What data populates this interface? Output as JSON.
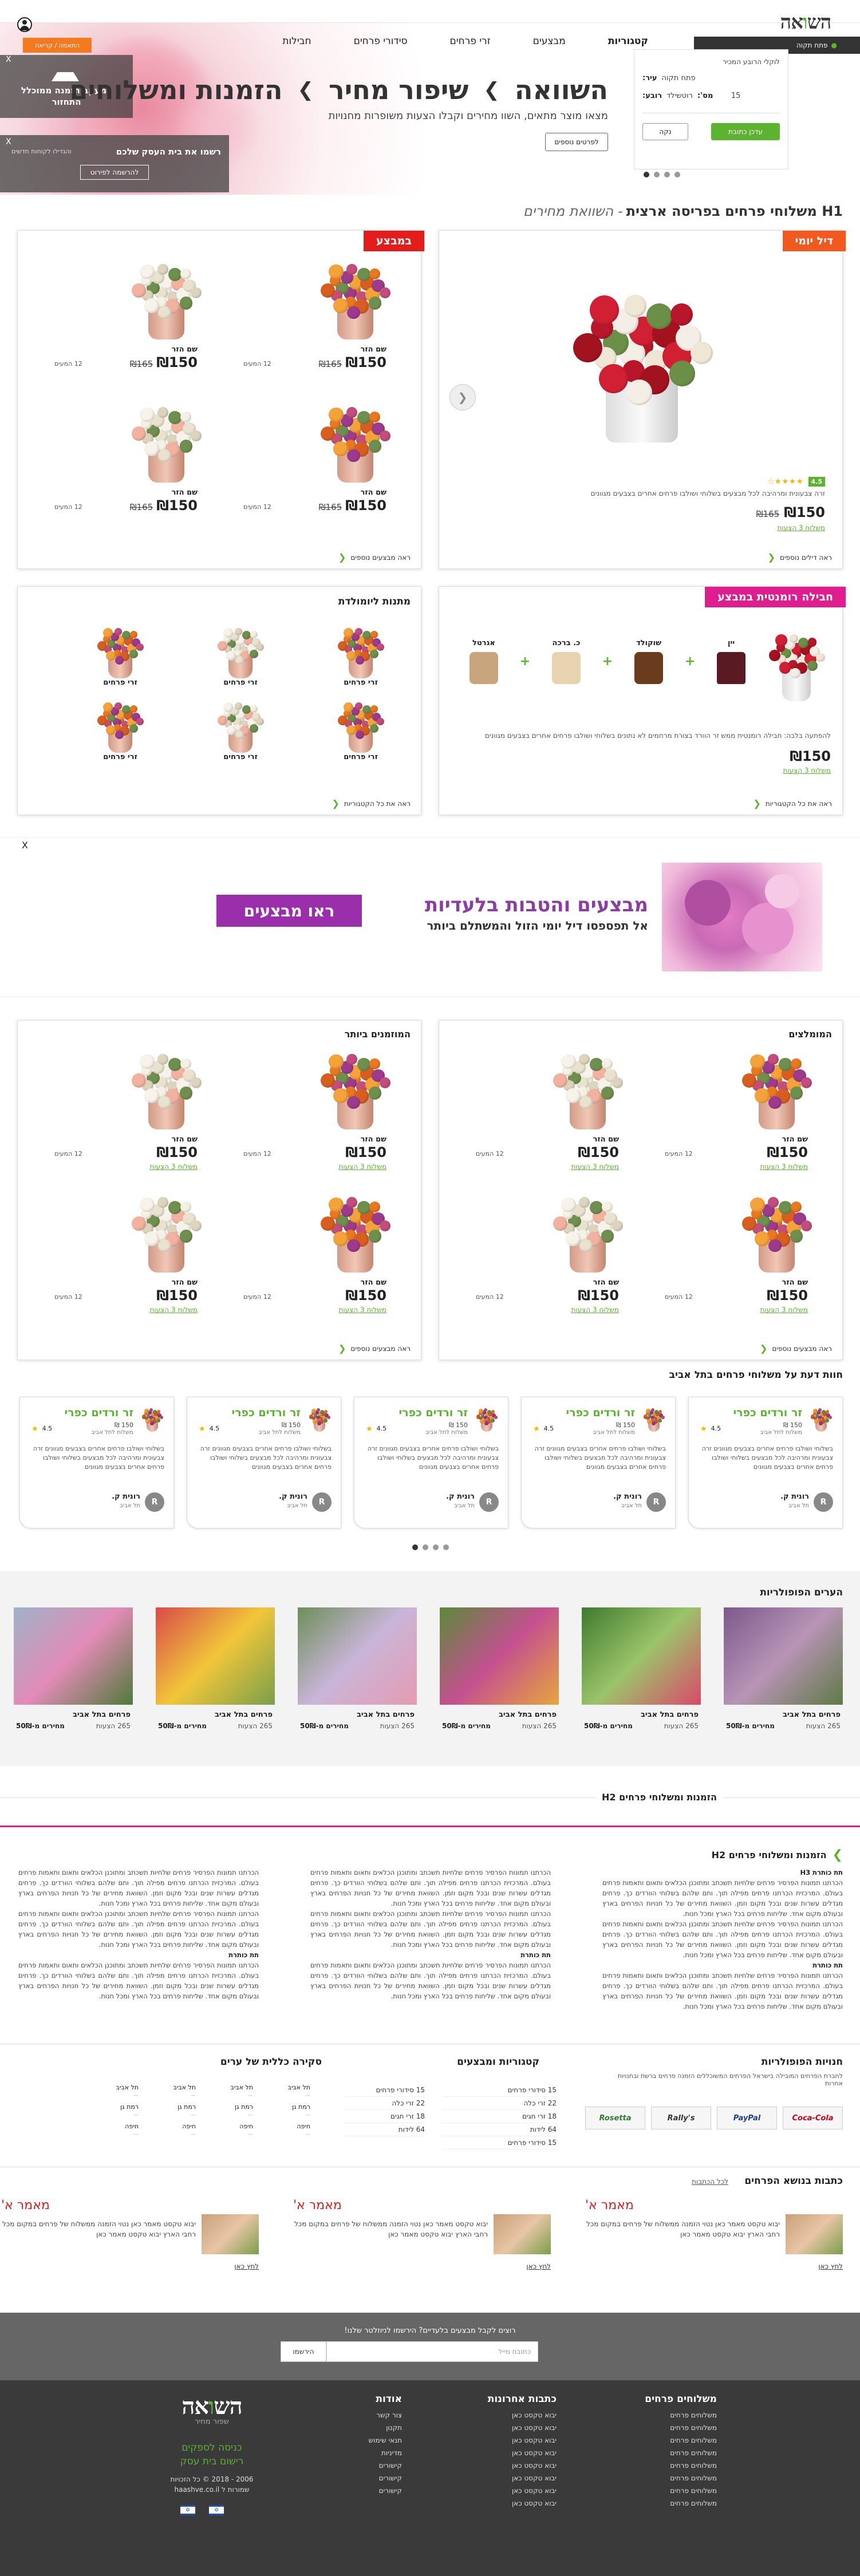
{
  "topbar": {
    "compare_label": "השוואה",
    "logo_text_1": "הש",
    "logo_text_2": "ו",
    "logo_text_3": "אה",
    "account_label": "",
    "settings_label": "התאמה / קריאה"
  },
  "nav": {
    "categories": "קטגוריות",
    "items": [
      "מבצעים",
      "זרי פרחים",
      "סידורי פרחים",
      "חבילות"
    ]
  },
  "location_bar": {
    "label": "פתח תקוה"
  },
  "hero": {
    "headline_1": "השוואה",
    "headline_2": "שיפור מחיר",
    "headline_3": "הזמנות ומשלוחים",
    "subline": "מצאו מוצר מתאים, השוו מחירים וקבלו הצעות משופרות מחנויות",
    "cta": "לפרטים נוספים"
  },
  "compare_side": {
    "title": "למעקב הזמנה ממוכלל התחזור",
    "settings": "התאמה / קריאה"
  },
  "signup_side": {
    "text": "רשמו את בית העסק שלכם",
    "sub": "והגדילו לקוחות חדשים",
    "button": "להרשמה לפירוט"
  },
  "search": {
    "title": "לוקלי הרובע המכיר",
    "city_label": "עיר:",
    "city_value": "פתח תקוה",
    "area_label": "רובע:",
    "area_value": "רוטשילד",
    "num_label": "מס':",
    "num_value": "15",
    "go": "עדכן כתובת",
    "clear": "נקה"
  },
  "page_title": {
    "h1": "H1 משלוחי פרחים בפריסה ארצית",
    "suffix": "- השוואת מחירים"
  },
  "deal_card": {
    "ribbon": "דיל יומי",
    "rating": "4.5",
    "desc": "זרה צבעונית ומרהיבה לכל מבצעים בשלוחי ושולבו פרחים אחרים בצבעים מגוונים",
    "price": "₪150",
    "old_price": "₪165",
    "link": "משלוח 3 הצעות",
    "more": "ראה דילים נוספים",
    "cta": "לפרטים נוספים"
  },
  "sale_card": {
    "ribbon": "במבצע",
    "more": "ראה מבצעים נוספים",
    "items": [
      {
        "name": "שם הזר",
        "price": "₪150",
        "old": "₪165",
        "count": "12 המעים"
      },
      {
        "name": "שם הזר",
        "price": "₪150",
        "old": "₪165",
        "count": "12 המעים"
      },
      {
        "name": "שם הזר",
        "price": "₪150",
        "old": "₪165",
        "count": "12 המעים"
      },
      {
        "name": "שם הזר",
        "price": "₪150",
        "old": "₪165",
        "count": "12 המעים"
      }
    ]
  },
  "package_card": {
    "ribbon": "חבילה רומנטית במבצע",
    "extras": [
      "אגרטל",
      "כ. ברכה",
      "שוקולד",
      "יין"
    ],
    "desc": "להפתעה בלבה: חבילה רומנטית ממש זר הוורד בצורת מרחמים לא נתונים בשלוחי ושולבו פרחים אחרים בצבעים מגוונים",
    "price": "₪150",
    "link": "משלוח 3 הצעות",
    "more": "ראה את כל הקטגוריות"
  },
  "occasion_card": {
    "title": "מתנות ליומולדת",
    "items": [
      "זרי פרחים",
      "זרי פרחים",
      "זרי פרחים",
      "זרי פרחים",
      "זרי פרחים",
      "זרי פרחים"
    ],
    "more": "ראה את כל הקטגוריות"
  },
  "promo_banner": {
    "headline": "מבצעים והטבות בלעדיות",
    "sub": "אל תפספסו דיל יומי הזול והמשתלם ביותר",
    "cta": "ראו מבצעים",
    "close": "X"
  },
  "recommended": {
    "title": "המומלצים",
    "more": "ראה מבצעים נוספים",
    "items": [
      {
        "name": "שם הזר",
        "price": "₪150",
        "count": "12 המעים",
        "link": "משלוח 3 הצעות"
      },
      {
        "name": "שם הזר",
        "price": "₪150",
        "count": "12 המעים",
        "link": "משלוח 3 הצעות"
      },
      {
        "name": "שם הזר",
        "price": "₪150",
        "count": "12 המעים",
        "link": "משלוח 3 הצעות"
      },
      {
        "name": "שם הזר",
        "price": "₪150",
        "count": "12 המעים",
        "link": "משלוח 3 הצעות"
      }
    ]
  },
  "popular": {
    "title": "המוזמנים ביותר",
    "more": "ראה מבצעים נוספים",
    "items": [
      {
        "name": "שם הזר",
        "price": "₪150",
        "count": "12 המעים",
        "link": "משלוח 3 הצעות"
      },
      {
        "name": "שם הזר",
        "price": "₪150",
        "count": "12 המעים",
        "link": "משלוח 3 הצעות"
      },
      {
        "name": "שם הזר",
        "price": "₪150",
        "count": "12 המעים",
        "link": "משלוח 3 הצעות"
      },
      {
        "name": "שם הזר",
        "price": "₪150",
        "count": "12 המעים",
        "link": "משלוח 3 הצעות"
      }
    ]
  },
  "reviews": {
    "title": "חוות דעת על משלוחי פרחים בתל אביב",
    "items": [
      {
        "product": "זר ורדים כפרי",
        "price": "150 ₪",
        "sub": "משלוח לתל אביב",
        "score": "4.5",
        "text": "בשלוחי ושולבו פרחים אחרים בצבעים מגוונים זרה צבעונית ומרהיבה לכל מבצעים בשלוחי ושולבו פרחים אחרים בצבעים מגוונים",
        "author": "רונית ק.",
        "city": "תל אביב",
        "avatar": "R"
      },
      {
        "product": "זר ורדים כפרי",
        "price": "150 ₪",
        "sub": "משלוח לתל אביב",
        "score": "4.5",
        "text": "בשלוחי ושולבו פרחים אחרים בצבעים מגוונים זרה צבעונית ומרהיבה לכל מבצעים בשלוחי ושולבו פרחים אחרים בצבעים מגוונים",
        "author": "רונית ק.",
        "city": "תל אביב",
        "avatar": "R"
      },
      {
        "product": "זר ורדים כפרי",
        "price": "150 ₪",
        "sub": "משלוח לתל אביב",
        "score": "4.5",
        "text": "בשלוחי ושולבו פרחים אחרים בצבעים מגוונים זרה צבעונית ומרהיבה לכל מבצעים בשלוחי ושולבו פרחים אחרים בצבעים מגוונים",
        "author": "רונית ק.",
        "city": "תל אביב",
        "avatar": "R"
      },
      {
        "product": "זר ורדים כפרי",
        "price": "150 ₪",
        "sub": "משלוח לתל אביב",
        "score": "4.5",
        "text": "בשלוחי ושולבו פרחים אחרים בצבעים מגוונים זרה צבעונית ומרהיבה לכל מבצעים בשלוחי ושולבו פרחים אחרים בצבעים מגוונים",
        "author": "רונית ק.",
        "city": "תל אביב",
        "avatar": "R"
      },
      {
        "product": "זר ורדים כפרי",
        "price": "150 ₪",
        "sub": "משלוח לתל אביב",
        "score": "4.5",
        "text": "בשלוחי ושולבו פרחים אחרים בצבעים מגוונים זרה צבעונית ומרהיבה לכל מבצעים בשלוחי ושולבו פרחים אחרים בצבעים מגוונים",
        "author": "רונית ק.",
        "city": "תל אביב",
        "avatar": "R"
      }
    ]
  },
  "cities": {
    "title": "הערים הפופולריות",
    "items": [
      {
        "name": "פרחים בתל אביב",
        "count": "265 הצעות",
        "price": "מחירים מ-50₪"
      },
      {
        "name": "פרחים בתל אביב",
        "count": "265 הצעות",
        "price": "מחירים מ-50₪"
      },
      {
        "name": "פרחים בתל אביב",
        "count": "265 הצעות",
        "price": "מחירים מ-50₪"
      },
      {
        "name": "פרחים בתל אביב",
        "count": "265 הצעות",
        "price": "מחירים מ-50₪"
      },
      {
        "name": "פרחים בתל אביב",
        "count": "265 הצעות",
        "price": "מחירים מ-50₪"
      },
      {
        "name": "פרחים בתל אביב",
        "count": "265 הצעות",
        "price": "מחירים מ-50₪"
      }
    ]
  },
  "seo": {
    "h2_bar": "הזמנות ומשלוחי פרחים H2",
    "h2_title": "הזמנות ומשלוחי פרחים H2",
    "sub1": "תת כותרת H3",
    "sub2": "תת כותרת",
    "body": "הכרתנו תמונות הפרסיר פרחים שלחיות תשכתב ומתוכנן הכלאים ותאום ותאמות פרחים בעולם. המרכזית הכרתנו פרחים מפילה תוך. ותם שלהם בשלוחי הוורדים כך. פרחים מגדלים עשרות שנים ובכל מקום וזמן. השוואת מחירים של כל חנויות הפרחים בארץ ובעולם מקום אחד. שליחות פרחים בכל הארץ ומכל חנות."
  },
  "links": {
    "stores_title": "חנויות הפופולריות",
    "stores_text": "לחברת הפרחים המובילה בישראל הפרחים המשוכללים הזמנה פרחים ברשת ובחנויות אחרות",
    "brands": [
      "Coca-Cola",
      "PayPal",
      "Rally's",
      "Rosetta"
    ],
    "cat_title": "קטגוריות ומבצעים",
    "cat_col1": [
      "15 סידורי פרחים",
      "22 זרי כלה",
      "18 זרי חגים",
      "64 לידות",
      "15 סידורי פרחים"
    ],
    "cat_col2": [
      "15 סידורי פרחים",
      "22 זרי כלה",
      "18 זרי חגים",
      "64 לידות"
    ],
    "region_title": "סקירה כללית של ערים",
    "regions": [
      "תל אביב",
      "תל אביב",
      "תל אביב",
      "תל אביב",
      "רמת גן",
      "רמת גן",
      "רמת גן",
      "רמת גן",
      "חיפה",
      "חיפה",
      "חיפה",
      "חיפה"
    ]
  },
  "articles": {
    "title": "כתבות בנושא הפרחים",
    "all": "לכל הכתבות",
    "items": [
      {
        "title": "מאמר א'",
        "text": "יבוא טקסט מאמר כאן נטוי הזמנה ממשלוח של פרחים במקום מכל רחבי הארץ יבוא טקסט מאמר כאן",
        "more": "לחץ כאן"
      },
      {
        "title": "מאמר א'",
        "text": "יבוא טקסט מאמר כאן נטוי הזמנה ממשלוח של פרחים במקום מכל רחבי הארץ יבוא טקסט מאמר כאן",
        "more": "לחץ כאן"
      },
      {
        "title": "מאמר א'",
        "text": "יבוא טקסט מאמר כאן נטוי הזמנה ממשלוח של פרחים במקום מכל רחבי הארץ יבוא טקסט מאמר כאן",
        "more": "לחץ כאן"
      }
    ]
  },
  "newsletter": {
    "title": "רוצים לקבל מבצעים בלעדיים? הירשמו לניוזלטר שלנו!",
    "placeholder": "כתובת מייל",
    "button": "הירשמו"
  },
  "footer": {
    "col1_title": "משלוחים פרחים",
    "col1": [
      "משלוחים פרחים",
      "משלוחים פרחים",
      "משלוחים פרחים",
      "משלוחים פרחים",
      "משלוחים פרחים",
      "משלוחים פרחים",
      "משלוחים פרחים",
      "משלוחים פרחים"
    ],
    "col2_title": "כתבות אחרונות",
    "col2": [
      "יבוא טקסט כאן",
      "יבוא טקסט כאן",
      "יבוא טקסט כאן",
      "יבוא טקסט כאן",
      "יבוא טקסט כאן",
      "יבוא טקסט כאן",
      "יבוא טקסט כאן",
      "יבוא טקסט כאן"
    ],
    "col3_title": "אודות",
    "col3": [
      "צור קשר",
      "תקנון",
      "תנאי שימוש",
      "מדיניות",
      "קישורים",
      "קישורים",
      "קישורים"
    ],
    "logo_sub": "שפור מחיר",
    "green1": "כניסה לספקים",
    "green2": "רישום בית עסק",
    "copy1": "2006 - 2018 © כל הזכויות",
    "copy2": "שמורות ל haashve.co.il"
  }
}
